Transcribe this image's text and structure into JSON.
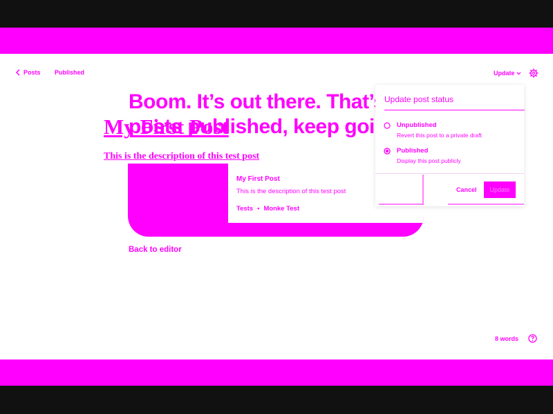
{
  "colors": {
    "accent": "#ff00ff",
    "frame": "#111111",
    "background": "#ffffff"
  },
  "header": {
    "back_label": "Posts",
    "back_icon": "chevron-left-icon",
    "status": "Published",
    "update_label": "Update",
    "update_icon": "chevron-down-icon",
    "settings_icon": "gear-icon"
  },
  "post": {
    "title": "My First Post",
    "description": "This is the description of this test post"
  },
  "success": {
    "headline": "Boom. It’s out there. That’s 8 posts published, keep going!"
  },
  "card": {
    "title": "My First Post",
    "description": "This is the description of this test post",
    "site": "Tests",
    "separator": "•",
    "author": "Monke Test"
  },
  "back_to_editor": "Back to editor",
  "status_panel": {
    "title": "Update post status",
    "options": [
      {
        "label": "Unpublished",
        "help": "Revert this post to a private draft",
        "selected": false
      },
      {
        "label": "Published",
        "help": "Display this post publicly",
        "selected": true
      }
    ],
    "cancel_label": "Cancel",
    "update_label": "Update"
  },
  "footer": {
    "word_count": "8 words",
    "help_icon": "help-icon"
  }
}
